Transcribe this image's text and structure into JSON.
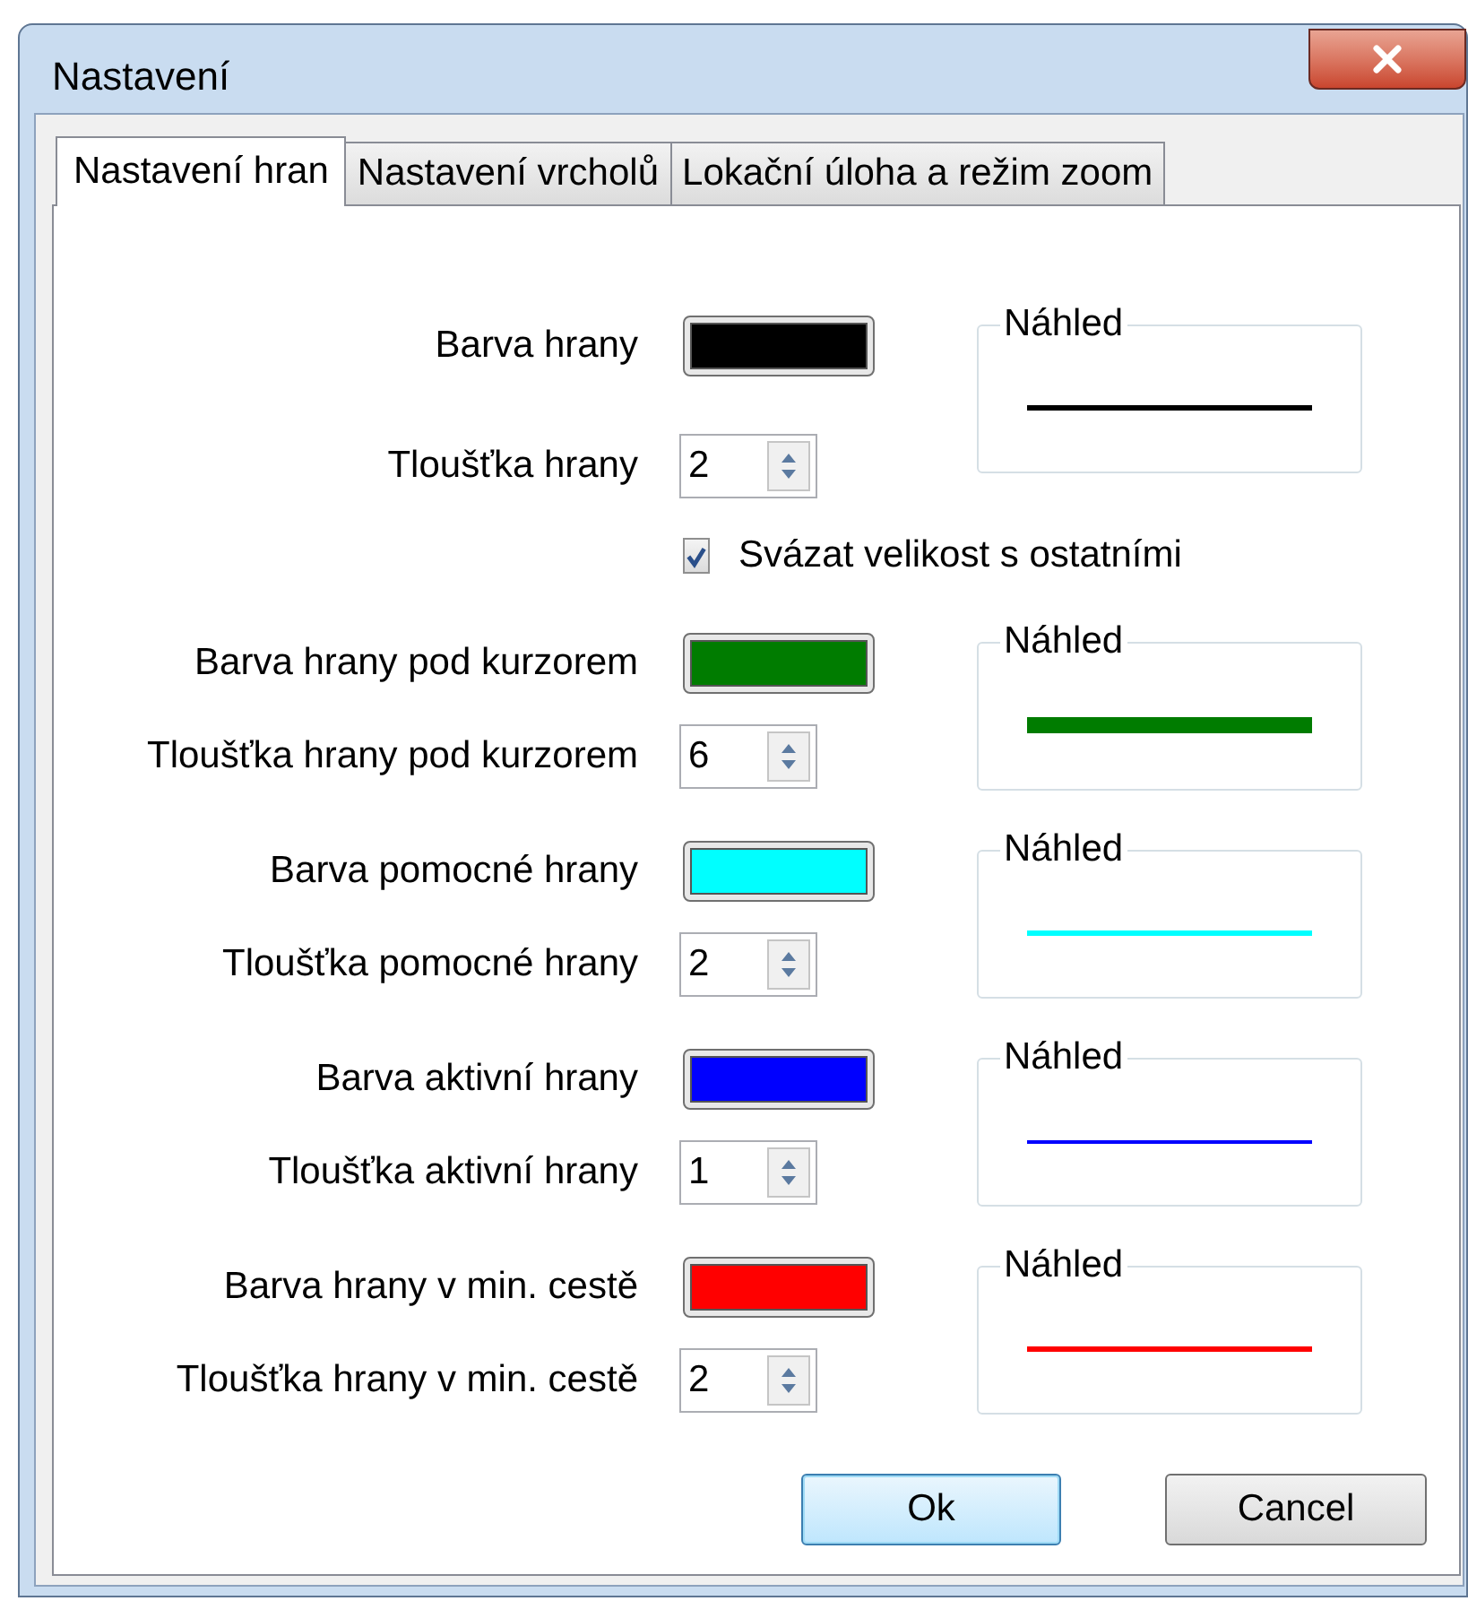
{
  "window": {
    "title": "Nastavení"
  },
  "tabs": [
    {
      "label": "Nastavení hran",
      "selected": true
    },
    {
      "label": "Nastavení vrcholů",
      "selected": false
    },
    {
      "label": "Lokační úloha a režim zoom",
      "selected": false
    }
  ],
  "edge_settings": [
    {
      "color_label": "Barva hrany",
      "color": "#000000",
      "thickness_label": "Tloušťka hrany",
      "thickness": "2",
      "preview_label": "Náhled",
      "link_checkbox": {
        "label": "Svázat velikost s ostatními",
        "checked": true
      }
    },
    {
      "color_label": "Barva hrany pod kurzorem",
      "color": "#007c00",
      "thickness_label": "Tloušťka hrany pod kurzorem",
      "thickness": "6",
      "preview_label": "Náhled"
    },
    {
      "color_label": "Barva pomocné hrany",
      "color": "#00ffff",
      "thickness_label": "Tloušťka pomocné hrany",
      "thickness": "2",
      "preview_label": "Náhled"
    },
    {
      "color_label": "Barva aktivní hrany",
      "color": "#0000ff",
      "thickness_label": "Tloušťka aktivní hrany",
      "thickness": "1",
      "preview_label": "Náhled"
    },
    {
      "color_label": "Barva hrany v min. cestě",
      "color": "#ff0000",
      "thickness_label": "Tloušťka hrany v min. cestě",
      "thickness": "2",
      "preview_label": "Náhled"
    }
  ],
  "buttons": [
    {
      "label": "Ok",
      "default": true
    },
    {
      "label": "Cancel",
      "default": false
    }
  ]
}
